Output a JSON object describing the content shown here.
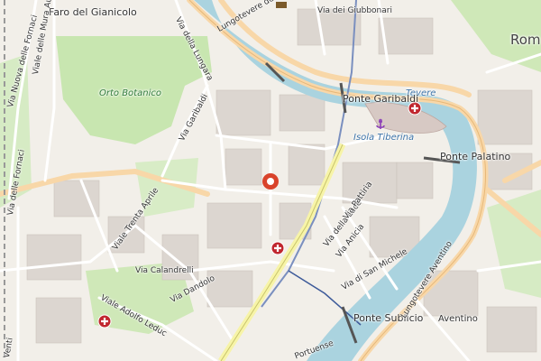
{
  "map": {
    "city_label": "Rom",
    "areas": {
      "orto_botanico": "Orto Botanico",
      "isola_tiberina": "Isola Tiberina",
      "tevere": "Tevere",
      "aventino": "Aventino"
    },
    "landmarks": {
      "faro": "Faro del Gianicolo"
    },
    "bridges": {
      "garibaldi": "Ponte Garibaldi",
      "palatino": "Ponte Palatino",
      "sublicio": "Ponte Sublicio"
    },
    "streets": {
      "nuova_fornaci": "Via Nuova delle Fornaci",
      "mura_aurelie": "Viale delle Mura Aurelie",
      "delle_fornaci": "Via delle Fornaci",
      "lungara": "Via della Lungara",
      "garibaldi": "Via Garibaldi",
      "tebaldi": "Lungotevere dei Tebaldi",
      "giubbonari": "Via dei Giubbonari",
      "trenta_aprile": "Viale Trenta Aprile",
      "calandrelli": "Via Calandrelli",
      "dandolo": "Via Dandolo",
      "adolfo_leduc": "Viale Adolfo Leduc",
      "luce": "Via della Luce",
      "anicia": "Via Anicia",
      "pattiria": "Via Pattiria",
      "san_michele": "Via di San Michele",
      "aventino_lungo": "Lungotevere Aventino",
      "portuense": "Portuense",
      "venti": "Venti"
    },
    "colors": {
      "water": "#aad3df",
      "park": "#c8e6b0",
      "road": "#ffffff",
      "major_road": "#f8d7a8",
      "tram": "#3d5a99",
      "marker": "#d9432b"
    },
    "icons": [
      "hospital-icon",
      "location-pin-icon",
      "anchor-icon",
      "landmark-icon"
    ]
  }
}
